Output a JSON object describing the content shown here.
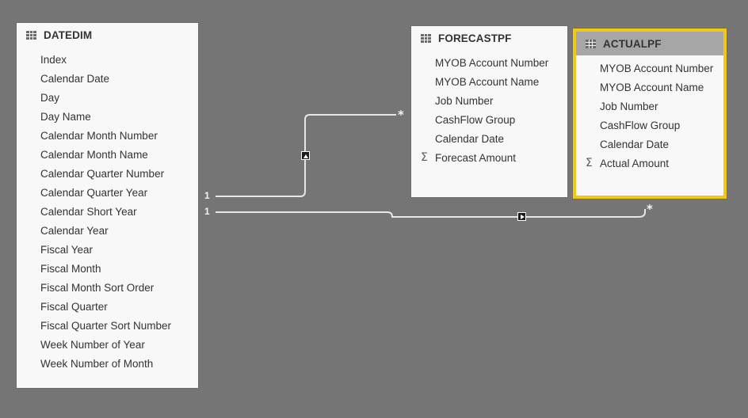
{
  "canvas": {
    "background_color": "#757575",
    "selection_color": "#f2c811",
    "line_color": "#e6e6e6"
  },
  "tables": [
    {
      "name": "DATEDIM",
      "icon": "table-grid-icon",
      "selected": false,
      "fields": [
        {
          "label": "Index",
          "aggregate": false
        },
        {
          "label": "Calendar Date",
          "aggregate": false
        },
        {
          "label": "Day",
          "aggregate": false
        },
        {
          "label": "Day Name",
          "aggregate": false
        },
        {
          "label": "Calendar Month Number",
          "aggregate": false
        },
        {
          "label": "Calendar Month Name",
          "aggregate": false
        },
        {
          "label": "Calendar Quarter Number",
          "aggregate": false
        },
        {
          "label": "Calendar Quarter Year",
          "aggregate": false
        },
        {
          "label": "Calendar  Short Year",
          "aggregate": false
        },
        {
          "label": "Calendar  Year",
          "aggregate": false
        },
        {
          "label": "Fiscal Year",
          "aggregate": false
        },
        {
          "label": "Fiscal Month",
          "aggregate": false
        },
        {
          "label": "Fiscal Month Sort Order",
          "aggregate": false
        },
        {
          "label": "Fiscal Quarter",
          "aggregate": false
        },
        {
          "label": "Fiscal Quarter Sort Number",
          "aggregate": false
        },
        {
          "label": "Week Number of Year",
          "aggregate": false
        },
        {
          "label": "Week Number of Month",
          "aggregate": false
        }
      ]
    },
    {
      "name": "FORECASTPF",
      "icon": "table-grid-icon",
      "selected": false,
      "fields": [
        {
          "label": "MYOB Account Number",
          "aggregate": false
        },
        {
          "label": "MYOB Account Name",
          "aggregate": false
        },
        {
          "label": "Job Number",
          "aggregate": false
        },
        {
          "label": "CashFlow Group",
          "aggregate": false
        },
        {
          "label": "Calendar Date",
          "aggregate": false
        },
        {
          "label": "Forecast Amount",
          "aggregate": true,
          "aggregate_symbol": "Σ"
        }
      ]
    },
    {
      "name": "ACTUALPF",
      "icon": "table-grid-icon",
      "selected": true,
      "fields": [
        {
          "label": "MYOB Account Number",
          "aggregate": false
        },
        {
          "label": "MYOB Account Name",
          "aggregate": false
        },
        {
          "label": "Job Number",
          "aggregate": false
        },
        {
          "label": "CashFlow Group",
          "aggregate": false
        },
        {
          "label": "Calendar Date",
          "aggregate": false
        },
        {
          "label": "Actual Amount",
          "aggregate": true,
          "aggregate_symbol": "Σ"
        }
      ]
    }
  ],
  "relationships": [
    {
      "id": "datedim-to-forecastpf",
      "from_table": "DATEDIM",
      "to_table": "FORECASTPF",
      "from_cardinality": "1",
      "to_cardinality": "*",
      "cross_filter_direction": "single-up",
      "arrow_icon": "triangle-up-icon"
    },
    {
      "id": "datedim-to-actualpf",
      "from_table": "DATEDIM",
      "to_table": "ACTUALPF",
      "from_cardinality": "1",
      "to_cardinality": "*",
      "cross_filter_direction": "single-right",
      "arrow_icon": "triangle-right-icon"
    }
  ]
}
